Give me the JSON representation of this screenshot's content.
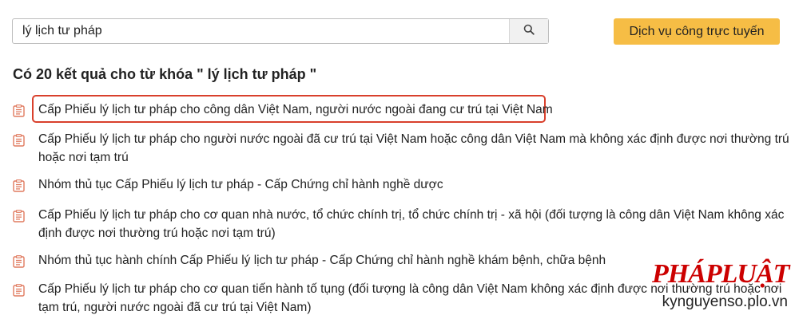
{
  "search": {
    "value": "lý lịch tư pháp",
    "placeholder": ""
  },
  "online_service_label": "Dịch vụ công trực tuyến",
  "results_heading": "Có 20 kết quả cho từ khóa \" lý lịch tư pháp \"",
  "results": [
    {
      "title": "Cấp Phiếu lý lịch tư pháp cho công dân Việt Nam, người nước ngoài đang cư trú tại Việt Nam",
      "highlighted": true
    },
    {
      "title": "Cấp Phiếu lý lịch tư pháp cho người nước ngoài đã cư trú tại Việt Nam hoặc công dân Việt Nam mà không xác định được nơi thường trú hoặc nơi tạm trú",
      "highlighted": false
    },
    {
      "title": "Nhóm thủ tục Cấp Phiếu lý lịch tư pháp - Cấp Chứng chỉ hành nghề dược",
      "highlighted": false
    },
    {
      "title": "Cấp Phiếu lý lịch tư pháp cho cơ quan nhà nước, tổ chức chính trị, tổ chức chính trị - xã hội (đối tượng là công dân Việt Nam không xác định được nơi thường trú hoặc nơi tạm trú)",
      "highlighted": false
    },
    {
      "title": "Nhóm thủ tục hành chính Cấp Phiếu lý lịch tư pháp - Cấp Chứng chỉ hành nghề khám bệnh, chữa bệnh",
      "highlighted": false
    },
    {
      "title": "Cấp Phiếu lý lịch tư pháp cho cơ quan tiến hành tố tụng (đối tượng là công dân Việt Nam không xác định được nơi thường trú hoặc nơi tạm trú, người nước ngoài đã cư trú tại Việt Nam)",
      "highlighted": false
    }
  ],
  "icons": {
    "search": "search-icon",
    "result": "document-icon"
  },
  "colors": {
    "accent_button": "#f6bd45",
    "highlight_border": "#d9402c",
    "doc_icon": "#e07a5f",
    "watermark_logo": "#cc0000"
  },
  "watermark": {
    "logo": "PHÁPLUẬT",
    "site": "kynguyenso.plo.vn"
  }
}
